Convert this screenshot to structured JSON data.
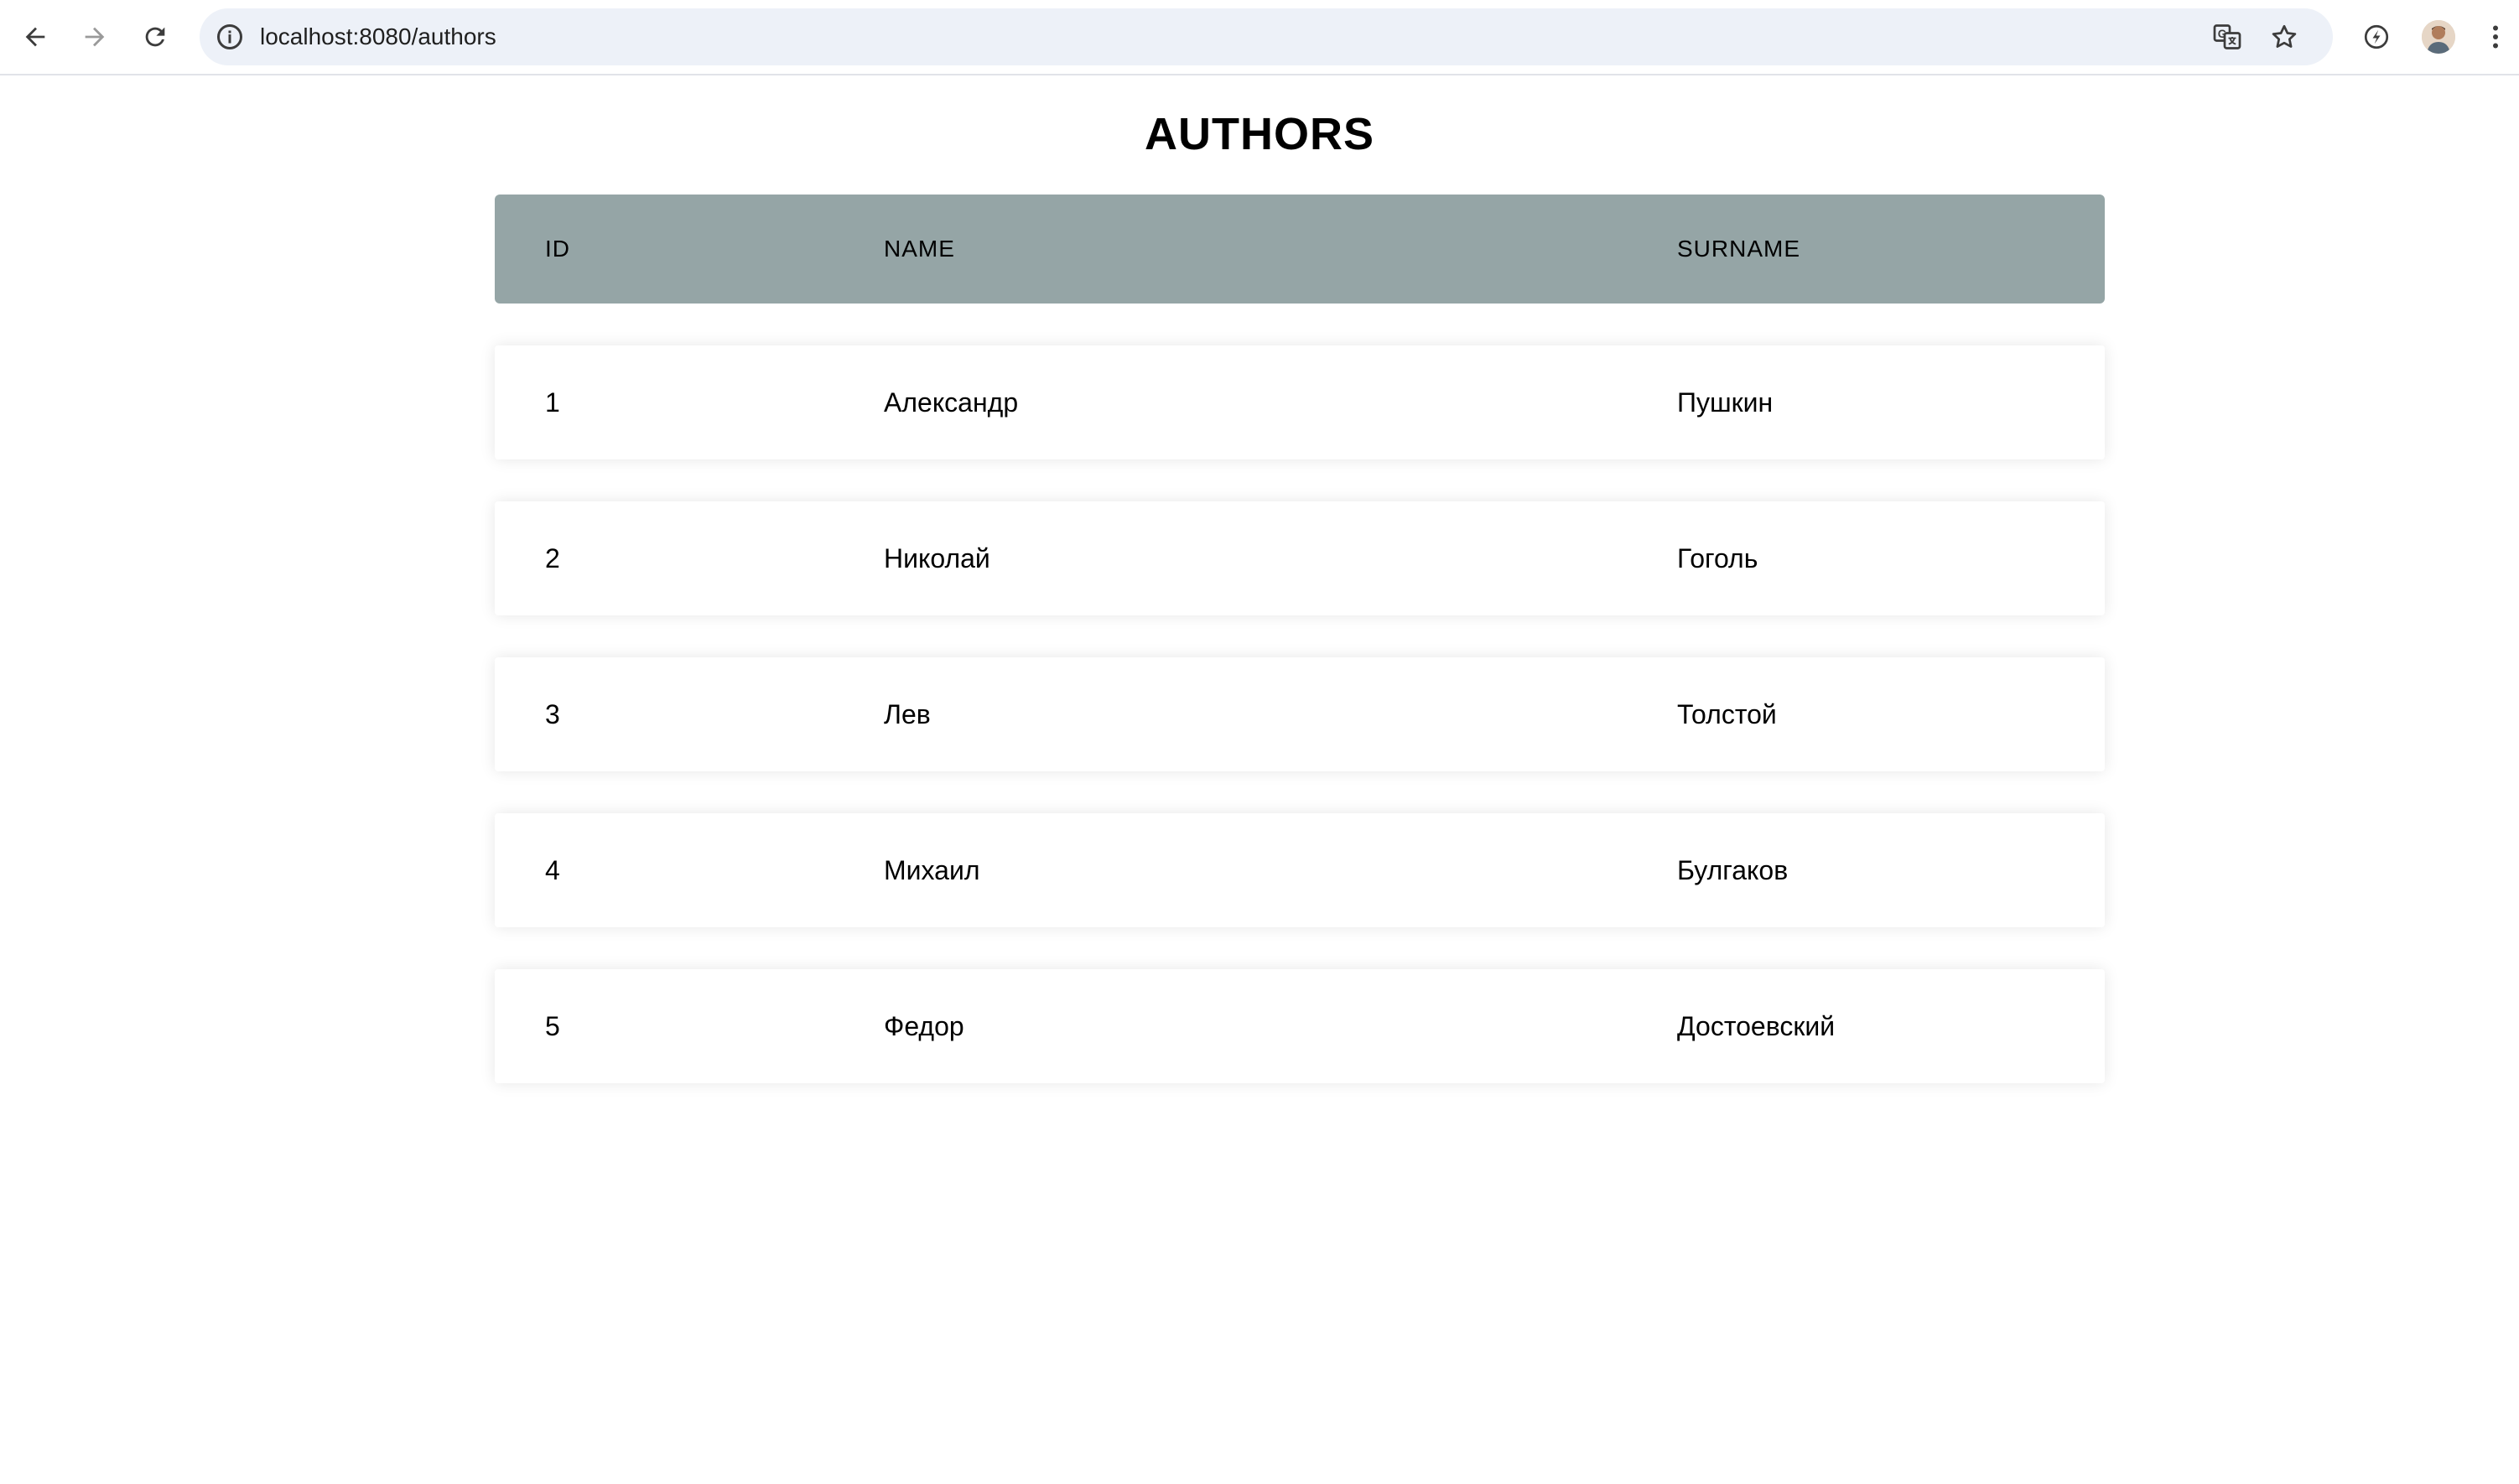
{
  "browser": {
    "url": "localhost:8080/authors"
  },
  "page": {
    "title": "AUTHORS"
  },
  "table": {
    "headers": {
      "id": "ID",
      "name": "NAME",
      "surname": "SURNAME"
    },
    "rows": [
      {
        "id": "1",
        "name": "Александр",
        "surname": "Пушкин"
      },
      {
        "id": "2",
        "name": "Николай",
        "surname": "Гоголь"
      },
      {
        "id": "3",
        "name": "Лев",
        "surname": "Толстой"
      },
      {
        "id": "4",
        "name": "Михаил",
        "surname": "Булгаков"
      },
      {
        "id": "5",
        "name": "Федор",
        "surname": "Достоевский"
      }
    ]
  },
  "colors": {
    "header_background": "#95a5a6",
    "omnibox_background": "#edf1f8"
  },
  "icons": {
    "back": "arrow-left-icon",
    "forward": "arrow-right-icon",
    "reload": "reload-icon",
    "site_info": "info-icon",
    "translate": "translate-icon",
    "bookmark": "star-icon",
    "performance": "speed-icon",
    "profile": "avatar",
    "menu": "kebab-menu-icon"
  }
}
